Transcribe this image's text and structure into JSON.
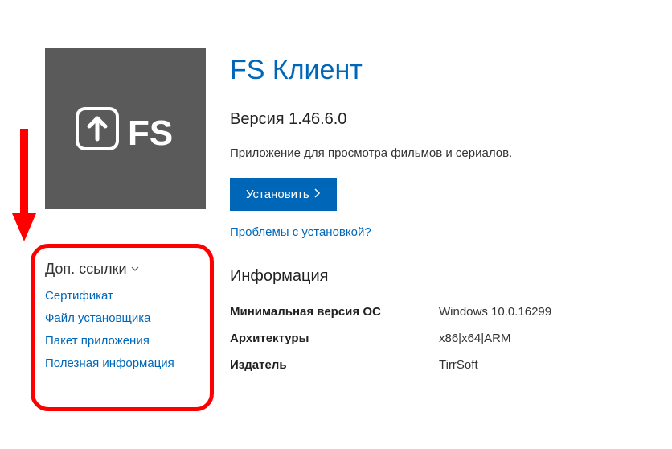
{
  "app": {
    "title": "FS Клиент",
    "version_label": "Версия 1.46.6.0",
    "description": "Приложение для просмотра фильмов и сериалов.",
    "install_label": "Установить",
    "trouble_label": "Проблемы с установкой?"
  },
  "additional": {
    "heading": "Доп. ссылки",
    "links": [
      "Сертификат",
      "Файл установщика",
      "Пакет приложения",
      "Полезная информация"
    ]
  },
  "info": {
    "heading": "Информация",
    "rows": [
      {
        "label": "Минимальная версия ОС",
        "value": "Windows 10.0.16299"
      },
      {
        "label": "Архитектуры",
        "value": "x86|x64|ARM"
      },
      {
        "label": "Издатель",
        "value": "TirrSoft"
      }
    ]
  }
}
